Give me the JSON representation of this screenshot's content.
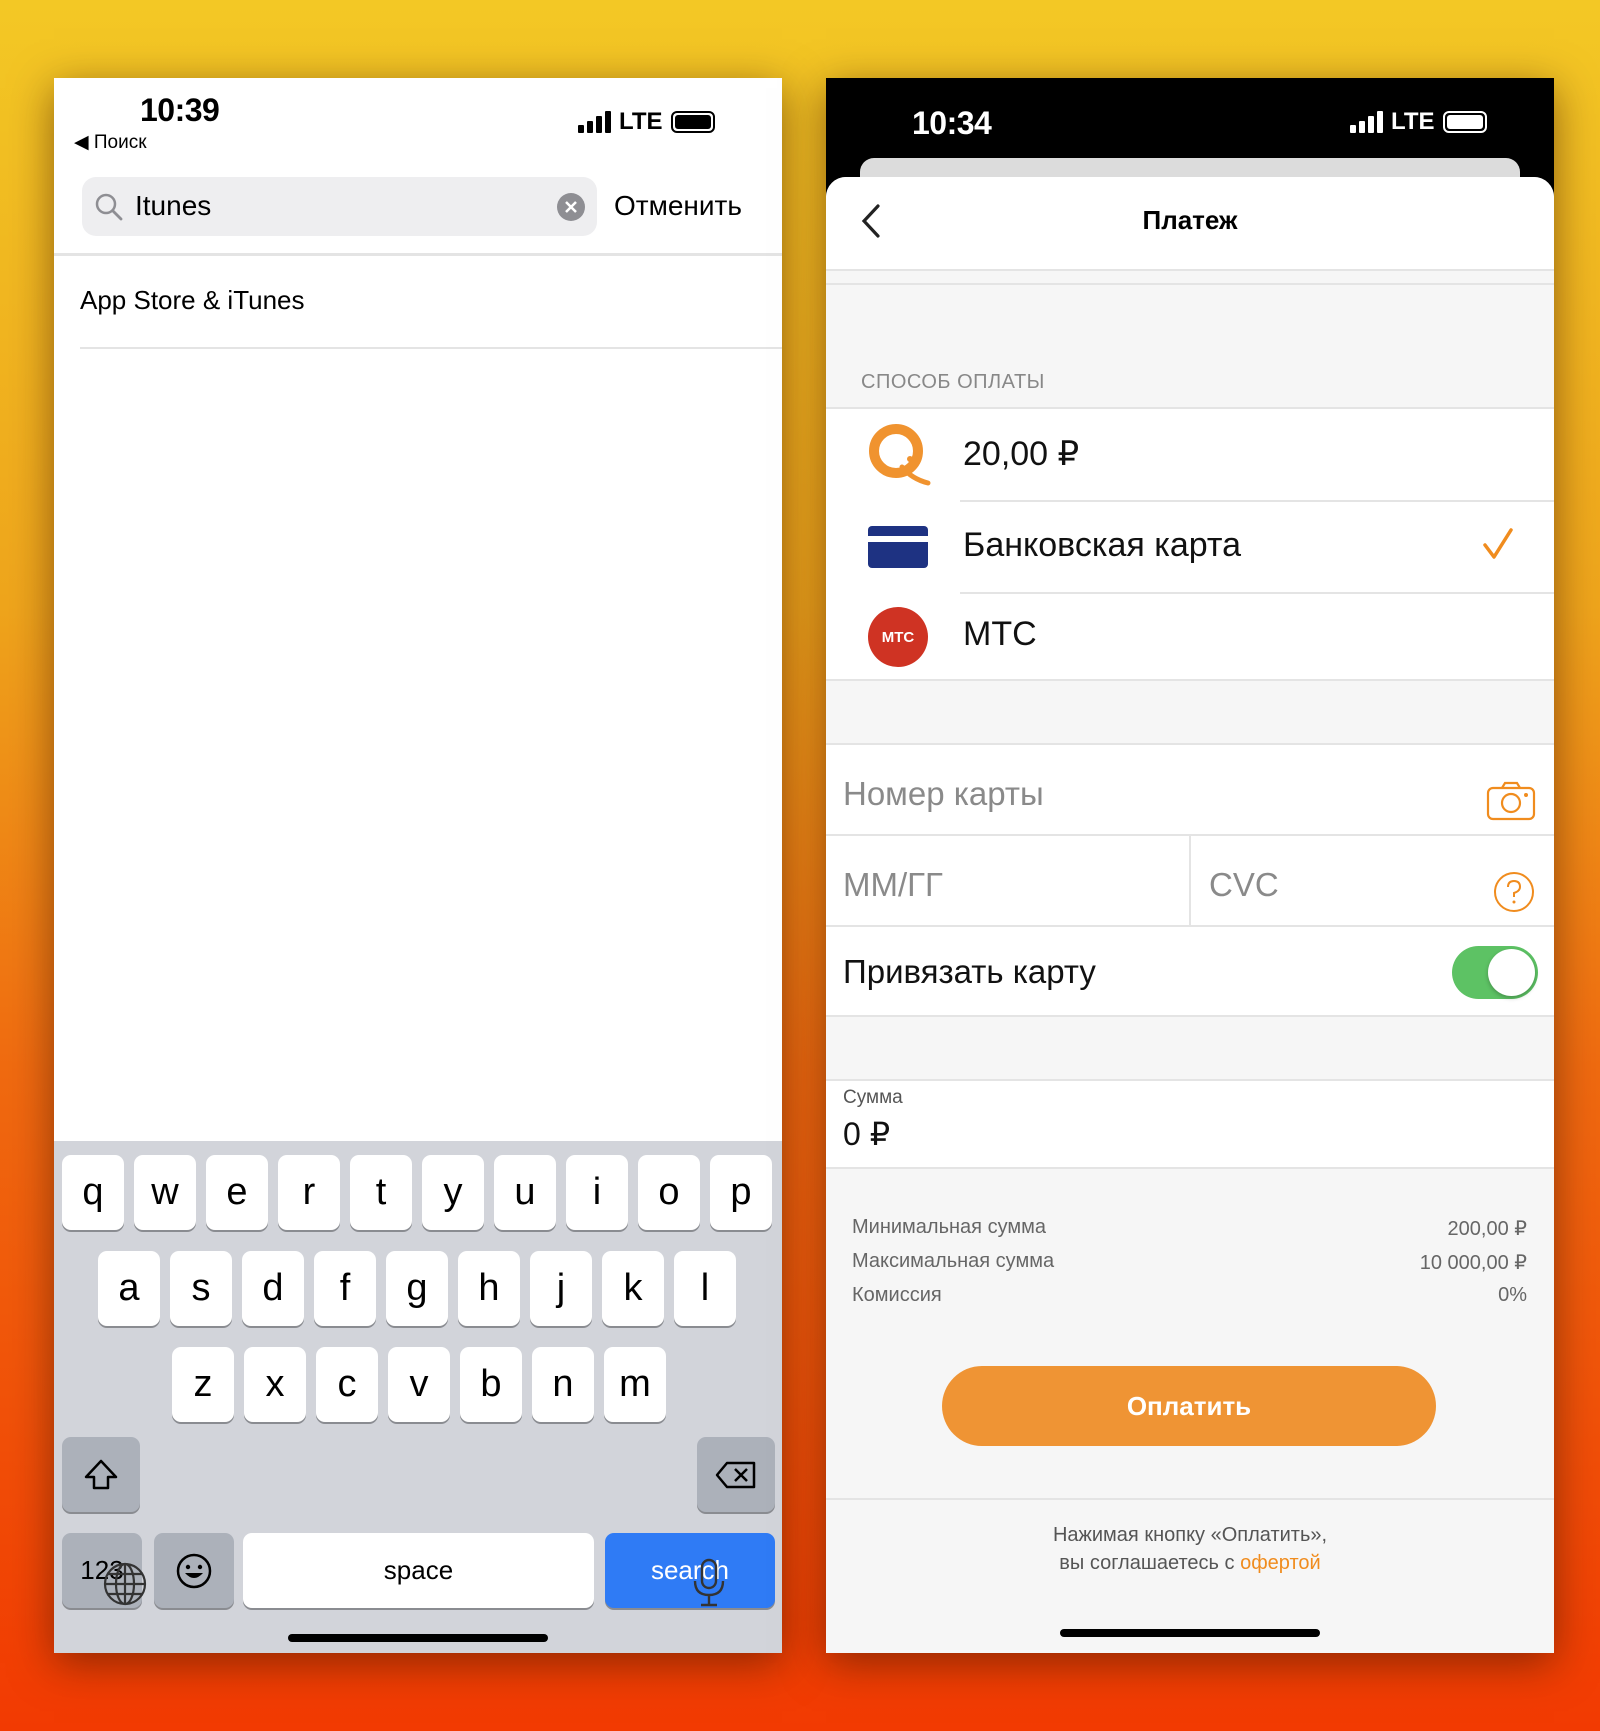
{
  "left_screen": {
    "status": {
      "time": "10:39",
      "back_label": "◀ Поиск",
      "network": "LTE",
      "battery_icon": "battery-full-icon"
    },
    "search": {
      "value": "Itunes",
      "icon": "search-icon",
      "clear_icon": "clear-icon",
      "cancel_label": "Отменить"
    },
    "results": [
      {
        "label": "App Store & iTunes"
      }
    ],
    "keyboard": {
      "rows": [
        [
          "q",
          "w",
          "e",
          "r",
          "t",
          "y",
          "u",
          "i",
          "o",
          "p"
        ],
        [
          "a",
          "s",
          "d",
          "f",
          "g",
          "h",
          "j",
          "k",
          "l"
        ],
        [
          "z",
          "x",
          "c",
          "v",
          "b",
          "n",
          "m"
        ]
      ],
      "shift_icon": "shift-icon",
      "delete_icon": "backspace-icon",
      "numbers_label": "123",
      "emoji_icon": "emoji-icon",
      "space_label": "space",
      "search_label": "search",
      "globe_icon": "globe-icon",
      "mic_icon": "microphone-icon",
      "search_key_color": "#2f7bf5"
    }
  },
  "right_screen": {
    "status": {
      "time": "10:34",
      "network": "LTE"
    },
    "header": {
      "title": "Платеж",
      "back_icon": "chevron-left-icon"
    },
    "payment_section_label": "СПОСОБ ОПЛАТЫ",
    "payment_methods": [
      {
        "label": "20,00 ₽",
        "icon": "qiwi-logo-icon",
        "selected": false
      },
      {
        "label": "Банковская карта",
        "icon": "bank-card-icon",
        "selected": true
      },
      {
        "label": "МТС",
        "icon": "mts-logo-icon",
        "logo_text": "МТС",
        "selected": false
      }
    ],
    "card_form": {
      "card_number_placeholder": "Номер карты",
      "expiry_placeholder": "ММ/ГГ",
      "cvc_placeholder": "CVC",
      "camera_icon": "camera-icon",
      "help_icon": "question-icon",
      "link_card_label": "Привязать карту",
      "link_card_enabled": true
    },
    "amount": {
      "label": "Сумма",
      "value": "0 ₽"
    },
    "limits": [
      {
        "label": "Минимальная сумма",
        "value": "200,00 ₽"
      },
      {
        "label": "Максимальная сумма",
        "value": "10 000,00 ₽"
      },
      {
        "label": "Комиссия",
        "value": "0%"
      }
    ],
    "pay_button_label": "Оплатить",
    "footer": {
      "line1": "Нажимая кнопку «Оплатить»,",
      "line2_prefix": "вы соглашаетесь с ",
      "link": "офертой"
    },
    "colors": {
      "accent": "#ef9434",
      "toggle": "#5dc264",
      "link": "#f08c1e",
      "card_icon": "#1e3282",
      "mts": "#cf3323"
    }
  }
}
